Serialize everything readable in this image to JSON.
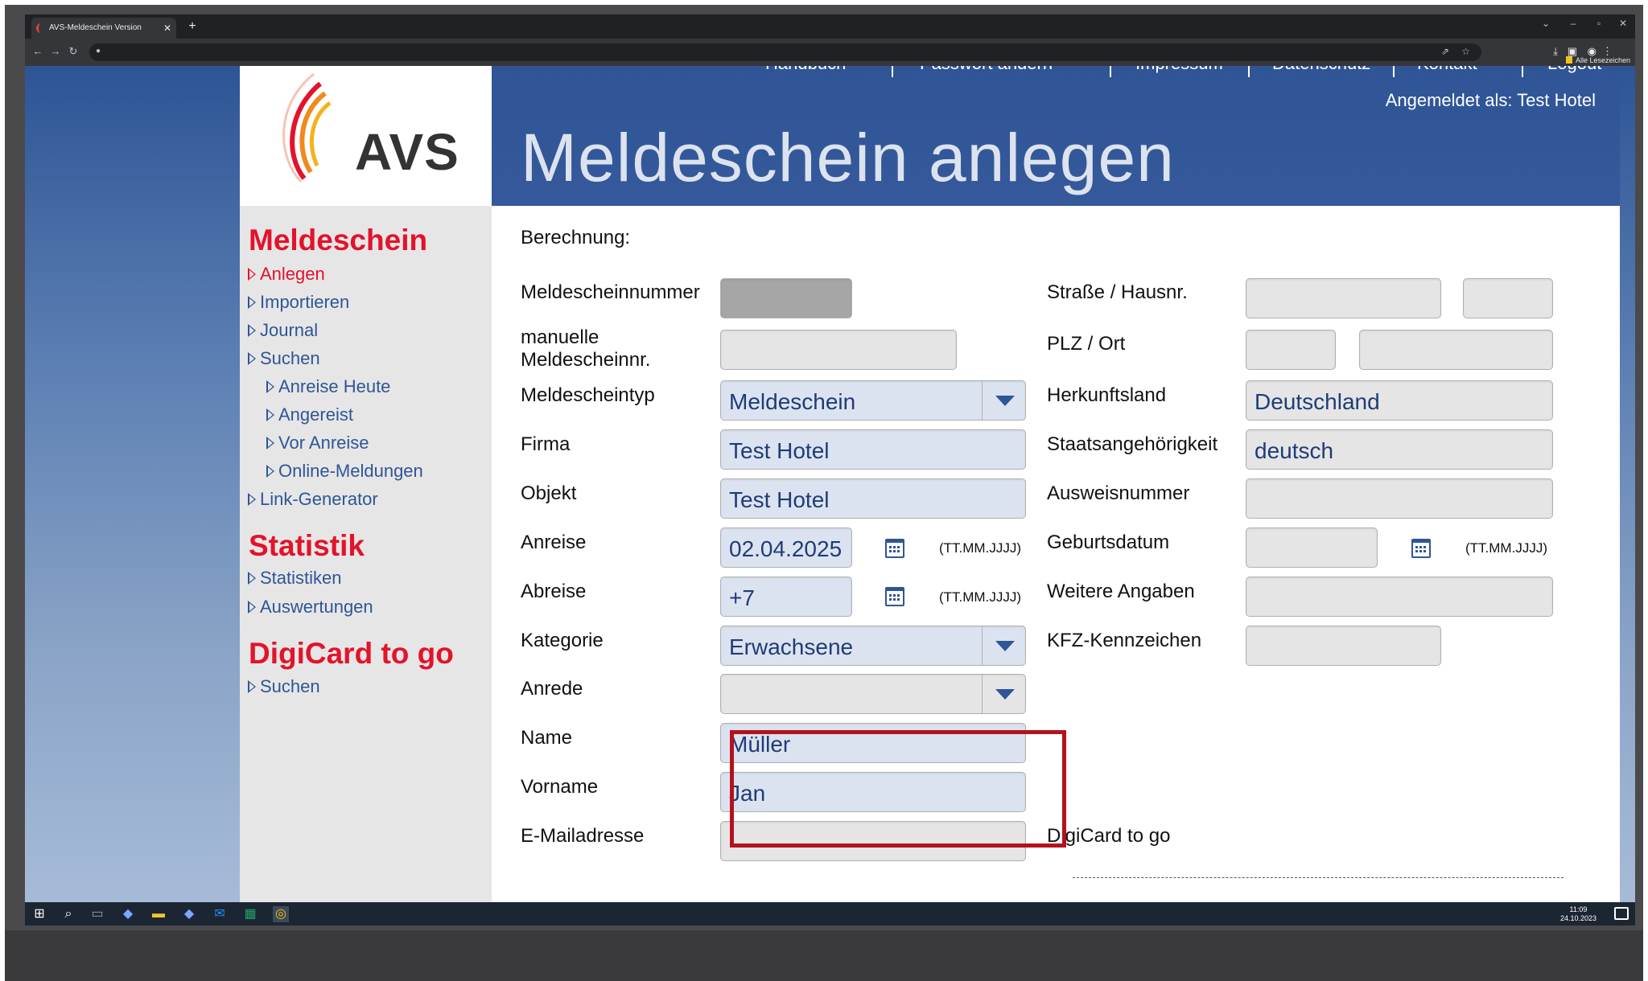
{
  "browser": {
    "tab_title": "AVS-Meldeschein Version",
    "new_tab": "+",
    "bookmarks_label": "Alle Lesezeichen"
  },
  "header": {
    "logo_text": "AVS",
    "nav": [
      "Handbuch",
      "Passwort ändern",
      "Impressum",
      "Datenschutz",
      "Kontakt",
      "Logout"
    ],
    "logged_in": "Angemeldet als: Test Hotel",
    "page_title": "Meldeschein anlegen"
  },
  "sidebar": {
    "meldeschein_heading": "Meldeschein",
    "meldeschein_items": [
      "Anlegen",
      "Importieren",
      "Journal",
      "Suchen"
    ],
    "suchen_sub": [
      "Anreise Heute",
      "Angereist",
      "Vor Anreise",
      "Online-Meldungen"
    ],
    "link_generator": "Link-Generator",
    "statistik_heading": "Statistik",
    "statistik_items": [
      "Statistiken",
      "Auswertungen"
    ],
    "digicard_heading": "DigiCard to go",
    "digicard_items": [
      "Suchen"
    ]
  },
  "form": {
    "berechnung": "Berechnung:",
    "left": {
      "meldescheinnummer": {
        "label": "Meldescheinnummer",
        "value": ""
      },
      "manuelle": {
        "label_1": "manuelle",
        "label_2": "Meldescheinnr.",
        "value": ""
      },
      "meldescheintyp": {
        "label": "Meldescheintyp",
        "value": "Meldeschein"
      },
      "firma": {
        "label": "Firma",
        "value": "Test Hotel"
      },
      "objekt": {
        "label": "Objekt",
        "value": "Test Hotel"
      },
      "anreise": {
        "label": "Anreise",
        "value": "02.04.2025",
        "hint": "(TT.MM.JJJJ)"
      },
      "abreise": {
        "label": "Abreise",
        "value": "+7",
        "hint": "(TT.MM.JJJJ)"
      },
      "kategorie": {
        "label": "Kategorie",
        "value": "Erwachsene"
      },
      "anrede": {
        "label": "Anrede",
        "value": ""
      },
      "name": {
        "label": "Name",
        "value": "Müller"
      },
      "vorname": {
        "label": "Vorname",
        "value": "Jan"
      },
      "email": {
        "label": "E-Mailadresse",
        "value": ""
      }
    },
    "right": {
      "strasse": {
        "label": "Straße / Hausnr.",
        "value": ""
      },
      "plz": {
        "label": "PLZ / Ort",
        "value": ""
      },
      "herkunftsland": {
        "label": "Herkunftsland",
        "value": "Deutschland"
      },
      "staatsangehoerigkeit": {
        "label": "Staatsangehörigkeit",
        "value": "deutsch"
      },
      "ausweisnummer": {
        "label": "Ausweisnummer",
        "value": ""
      },
      "geburtsdatum": {
        "label": "Geburtsdatum",
        "value": "",
        "hint": "(TT.MM.JJJJ)"
      },
      "weitere": {
        "label": "Weitere Angaben",
        "value": ""
      },
      "kfz": {
        "label": "KFZ-Kennzeichen",
        "value": ""
      },
      "digicard": {
        "label": "DigiCard to go"
      }
    }
  },
  "taskbar": {
    "time": "11:09",
    "date": "24.10.2023"
  },
  "colors": {
    "brand_blue": "#2f5597",
    "brand_red": "#e2132b",
    "highlight": "#b3121d"
  }
}
